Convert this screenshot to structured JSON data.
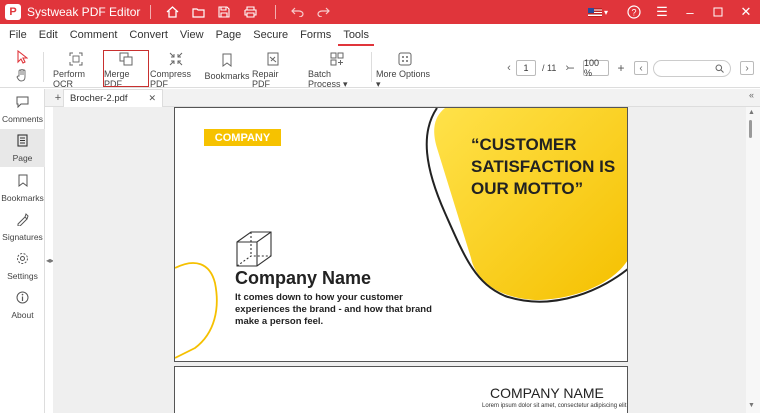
{
  "app": {
    "title": "Systweak PDF Editor",
    "logo_letter": "P"
  },
  "menu": [
    "File",
    "Edit",
    "Comment",
    "Convert",
    "View",
    "Page",
    "Secure",
    "Forms",
    "Tools"
  ],
  "active_menu": "Tools",
  "toolbar": {
    "tools": [
      {
        "label": "Perform OCR"
      },
      {
        "label": "Merge PDF"
      },
      {
        "label": "Compress PDF"
      },
      {
        "label": "Bookmarks"
      },
      {
        "label": "Repair PDF"
      },
      {
        "label": "Batch Process"
      },
      {
        "label": "More Options"
      }
    ],
    "page_current": "1",
    "page_total": "/ 11",
    "zoom": "100 %",
    "zoom_out": "−",
    "zoom_in": "+"
  },
  "sidebar": [
    {
      "label": "Comments",
      "icon": "comments-icon"
    },
    {
      "label": "Page",
      "icon": "page-icon"
    },
    {
      "label": "Bookmarks",
      "icon": "bookmarks-icon"
    },
    {
      "label": "Signatures",
      "icon": "signatures-icon"
    },
    {
      "label": "Settings",
      "icon": "settings-icon"
    },
    {
      "label": "About",
      "icon": "about-icon"
    }
  ],
  "active_sidebar": "Page",
  "tab": {
    "title": "Brocher-2.pdf"
  },
  "document": {
    "page1": {
      "tag": "COMPANY",
      "quote_lines": [
        "“CUSTOMER",
        "SATISFACTION IS",
        "OUR MOTTO”"
      ],
      "company_name": "Company Name",
      "description": "It comes down to how your customer experiences the brand - and how that brand make a person feel."
    },
    "page2": {
      "title": "COMPANY NAME",
      "subtitle": "Lorem ipsum dolor sit amet, consectetur adipiscing elit"
    }
  },
  "colors": {
    "brand_red": "#e0353b",
    "accent_yellow": "#f6c200"
  }
}
